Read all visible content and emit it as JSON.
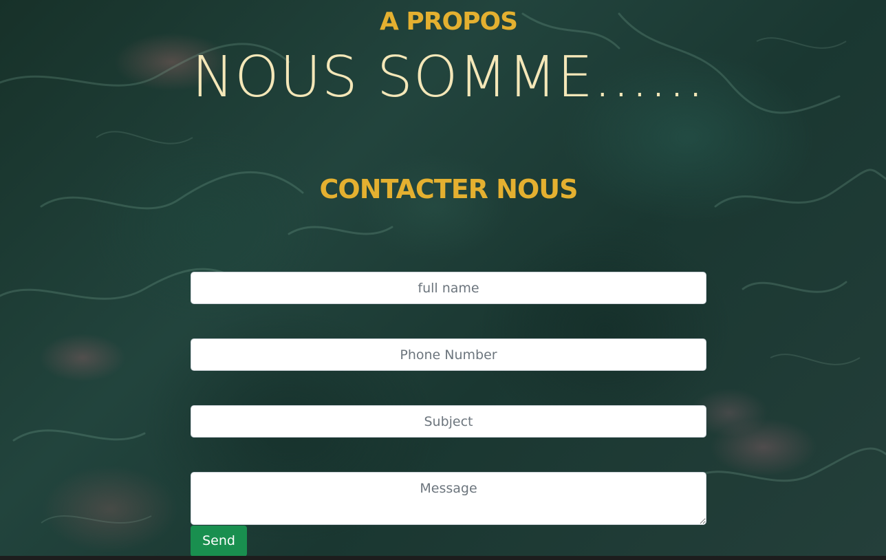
{
  "about": {
    "label": "A PROPOS",
    "title": "NOUS SOMME......"
  },
  "contact": {
    "title": "CONTACTER NOUS",
    "fields": {
      "full_name_placeholder": "full name",
      "phone_placeholder": "Phone Number",
      "subject_placeholder": "Subject",
      "message_placeholder": "Message"
    },
    "send_label": "Send"
  },
  "colors": {
    "accent_gold": "#e4b030",
    "title_cream": "#f4e7b8",
    "button_green": "#198f4f",
    "background": "#1c3a34"
  }
}
